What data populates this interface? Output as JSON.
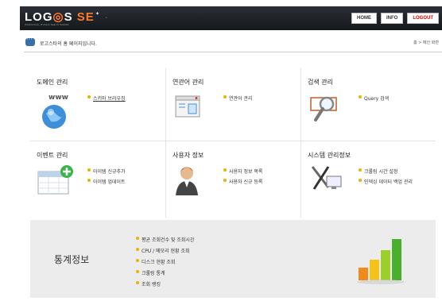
{
  "header": {
    "logo_main": "LOG",
    "logo_o": "◎",
    "logo_s": "S",
    "logo_se": "SE",
    "logo_sub": "Unstructure, IT Quick Search Solution",
    "nav": [
      {
        "label": "HOME"
      },
      {
        "label": "INFO"
      },
      {
        "label": "LOGOUT"
      }
    ]
  },
  "welcome": {
    "text": "로고스타의 홈 페이지입니다.",
    "breadcrumb": "홈 > 메인 화면"
  },
  "sections": [
    {
      "title": "도메인 관리",
      "icon": "globe-icon",
      "links": [
        "스키마 브라우징"
      ]
    },
    {
      "title": "연관어 관리",
      "icon": "window-icon",
      "links": [
        "연관어 관리"
      ]
    },
    {
      "title": "검색 관리",
      "icon": "magnifier-icon",
      "links": [
        "Query 검색"
      ]
    },
    {
      "title": "이벤트 관리",
      "icon": "calendar-add-icon",
      "links": [
        "아이템 신규추가",
        "아이템 업데이트"
      ]
    },
    {
      "title": "사용자 정보",
      "icon": "user-icon",
      "links": [
        "사용자 정보 목록",
        "사용자 신규 등록"
      ]
    },
    {
      "title": "시스템 관리정보",
      "icon": "tools-icon",
      "links": [
        "크롤링 시간 설정",
        "인덱싱 데이터 백업 관리"
      ]
    }
  ],
  "stats": {
    "title": "통계정보",
    "links": [
      "평균 조회건수 및 조회시간",
      "CPU / 메모리 현황 조회",
      "디스크 현황 조회",
      "크롤링 통계",
      "조회 랭킹"
    ],
    "icon": "bar-chart-icon"
  }
}
